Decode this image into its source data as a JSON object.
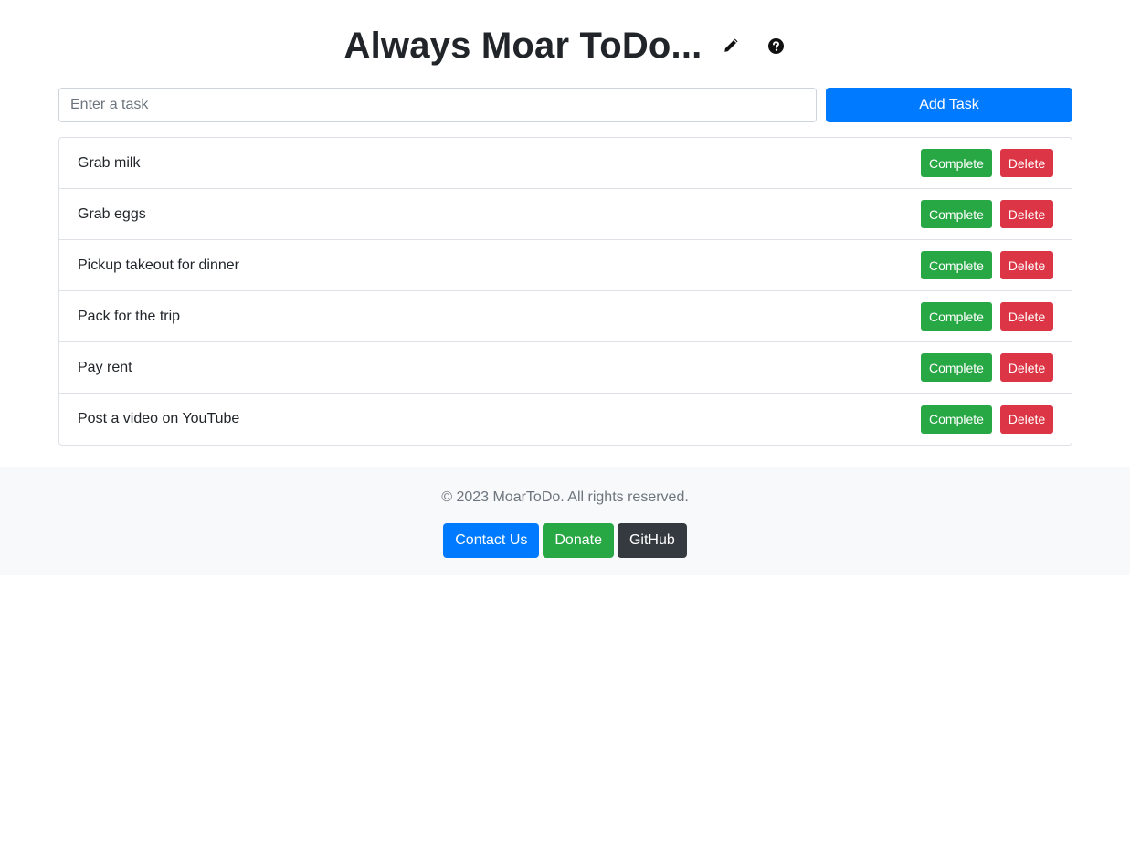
{
  "header": {
    "title": "Always Moar ToDo...",
    "edit_icon": "pencil-icon",
    "help_icon": "question-circle-icon"
  },
  "task_form": {
    "placeholder": "Enter a task",
    "value": "",
    "add_label": "Add Task"
  },
  "tasks": [
    {
      "text": "Grab milk",
      "complete_label": "Complete",
      "delete_label": "Delete"
    },
    {
      "text": "Grab eggs",
      "complete_label": "Complete",
      "delete_label": "Delete"
    },
    {
      "text": "Pickup takeout for dinner",
      "complete_label": "Complete",
      "delete_label": "Delete"
    },
    {
      "text": "Pack for the trip",
      "complete_label": "Complete",
      "delete_label": "Delete"
    },
    {
      "text": "Pay rent",
      "complete_label": "Complete",
      "delete_label": "Delete"
    },
    {
      "text": "Post a video on YouTube",
      "complete_label": "Complete",
      "delete_label": "Delete"
    }
  ],
  "footer": {
    "copyright": "© 2023 MoarToDo. All rights reserved.",
    "contact_label": "Contact Us",
    "donate_label": "Donate",
    "github_label": "GitHub"
  },
  "colors": {
    "primary": "#007bff",
    "success": "#28a745",
    "danger": "#dc3545",
    "dark": "#343a40",
    "footer_bg": "#f8f9fa"
  }
}
